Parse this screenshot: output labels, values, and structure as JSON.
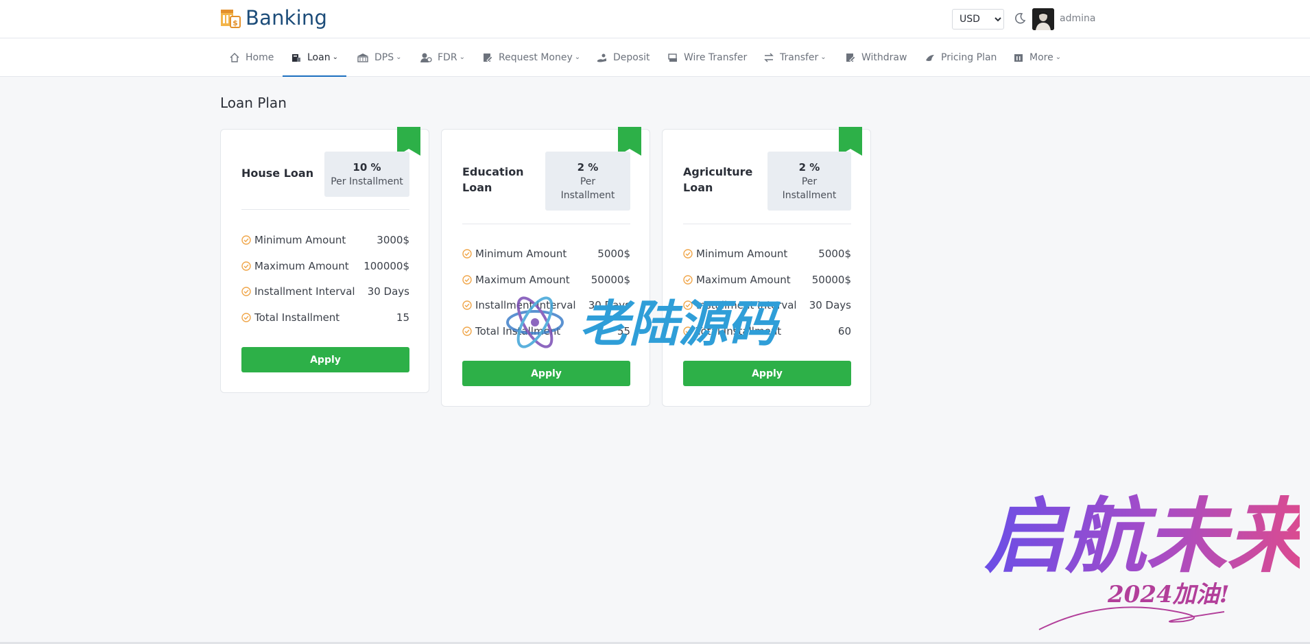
{
  "header": {
    "brand": "Banking",
    "currency": {
      "selected": "USD",
      "options": [
        "USD"
      ]
    },
    "user": {
      "name": "admina"
    }
  },
  "nav": {
    "items": [
      {
        "label": "Home",
        "icon": "home-icon",
        "dropdown": false
      },
      {
        "label": "Loan",
        "icon": "loan-icon",
        "dropdown": true,
        "active": true
      },
      {
        "label": "DPS",
        "icon": "dps-icon",
        "dropdown": true
      },
      {
        "label": "FDR",
        "icon": "fdr-icon",
        "dropdown": true
      },
      {
        "label": "Request Money",
        "icon": "request-money-icon",
        "dropdown": true
      },
      {
        "label": "Deposit",
        "icon": "deposit-icon",
        "dropdown": false
      },
      {
        "label": "Wire Transfer",
        "icon": "wire-transfer-icon",
        "dropdown": false
      },
      {
        "label": "Transfer",
        "icon": "transfer-icon",
        "dropdown": true
      },
      {
        "label": "Withdraw",
        "icon": "withdraw-icon",
        "dropdown": false
      },
      {
        "label": "Pricing Plan",
        "icon": "pricing-plan-icon",
        "dropdown": false
      },
      {
        "label": "More",
        "icon": "more-icon",
        "dropdown": true
      }
    ]
  },
  "page": {
    "title": "Loan Plan"
  },
  "plans": [
    {
      "name": "House Loan",
      "rate": "10 %",
      "rate_unit": "Per Installment",
      "rows": [
        {
          "label": "Minimum Amount",
          "value": "3000$"
        },
        {
          "label": "Maximum Amount",
          "value": "100000$"
        },
        {
          "label": "Installment Interval",
          "value": "30 Days"
        },
        {
          "label": "Total Installment",
          "value": "15"
        }
      ],
      "button": "Apply"
    },
    {
      "name": "Education Loan",
      "rate": "2 %",
      "rate_unit": "Per Installment",
      "rows": [
        {
          "label": "Minimum Amount",
          "value": "5000$"
        },
        {
          "label": "Maximum Amount",
          "value": "50000$"
        },
        {
          "label": "Installment Interval",
          "value": "30 Days"
        },
        {
          "label": "Total Installment",
          "value": "55"
        }
      ],
      "button": "Apply"
    },
    {
      "name": "Agriculture Loan",
      "rate": "2 %",
      "rate_unit": "Per Installment",
      "rows": [
        {
          "label": "Minimum Amount",
          "value": "5000$"
        },
        {
          "label": "Maximum Amount",
          "value": "50000$"
        },
        {
          "label": "Installment Interval",
          "value": "30 Days"
        },
        {
          "label": "Total Installment",
          "value": "60"
        }
      ],
      "button": "Apply"
    }
  ],
  "watermarks": {
    "center": "老陆源码",
    "corner_title": "启航未来",
    "corner_sub": "2024加油!"
  },
  "colors": {
    "brand": "#1c4c79",
    "accent": "#2db048",
    "active_nav": "#1c6fbf",
    "check": "#f0a64a"
  }
}
